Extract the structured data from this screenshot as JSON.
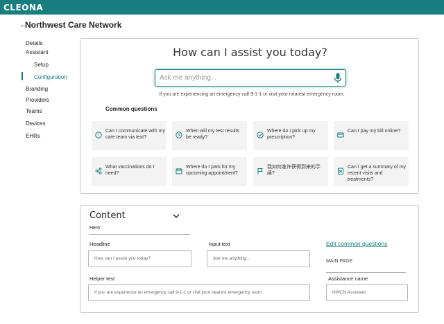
{
  "brand": {
    "logo": "CLEONA",
    "accent": "#177d7f"
  },
  "header": {
    "back_glyph": "←",
    "title": "Northwest Care Network"
  },
  "sidebar": {
    "items": [
      {
        "label": "Details"
      },
      {
        "label": "Assistant"
      },
      {
        "label": "Setup"
      },
      {
        "label": "Configuration",
        "active": true
      },
      {
        "label": "Branding"
      },
      {
        "label": "Providers"
      },
      {
        "label": "Teams"
      },
      {
        "label": "Devices"
      },
      {
        "label": "EHRs"
      }
    ]
  },
  "preview": {
    "heading": "How can I assist you today?",
    "search_placeholder": "Ask me anything...",
    "disclaimer": "If you are experiencing an emergency call 9-1-1 or visit your nearest emergency room.",
    "common_title": "Common questions",
    "questions": [
      {
        "text": "Can I communicate with my care team via text?",
        "icon": "question-circle-icon"
      },
      {
        "text": "When will my test results be ready?",
        "icon": "clock-icon"
      },
      {
        "text": "Where do I pick up my prescription?",
        "icon": "check-circle-icon"
      },
      {
        "text": "Can I pay my bill online?",
        "icon": "credit-card-icon"
      },
      {
        "text": "What vaccinations do I need?",
        "icon": "share-icon"
      },
      {
        "text": "Where do I park for my upcoming appointment?",
        "icon": "calendar-icon"
      },
      {
        "text": "我如何准许获得到来的手续?",
        "icon": "flag-icon"
      },
      {
        "text": "Can I get a summary of my recent visits and treatments?",
        "icon": "document-icon"
      }
    ]
  },
  "content": {
    "title": "Content",
    "hero_label": "Hero",
    "headline_label": "Headline",
    "headline_value": "How can I assist you today?",
    "input_label": "Input text",
    "input_value": "Ask me anything...",
    "helper_label": "Helper test",
    "helper_value": "If you are experience an emergency call 9-1-1 or visit your nearest emergency room.",
    "edit_link": "Edit common questions",
    "main_page": "MAIN PAGE",
    "assistance_label": "Assistance name",
    "assistance_value": "NWCN Assistant"
  }
}
